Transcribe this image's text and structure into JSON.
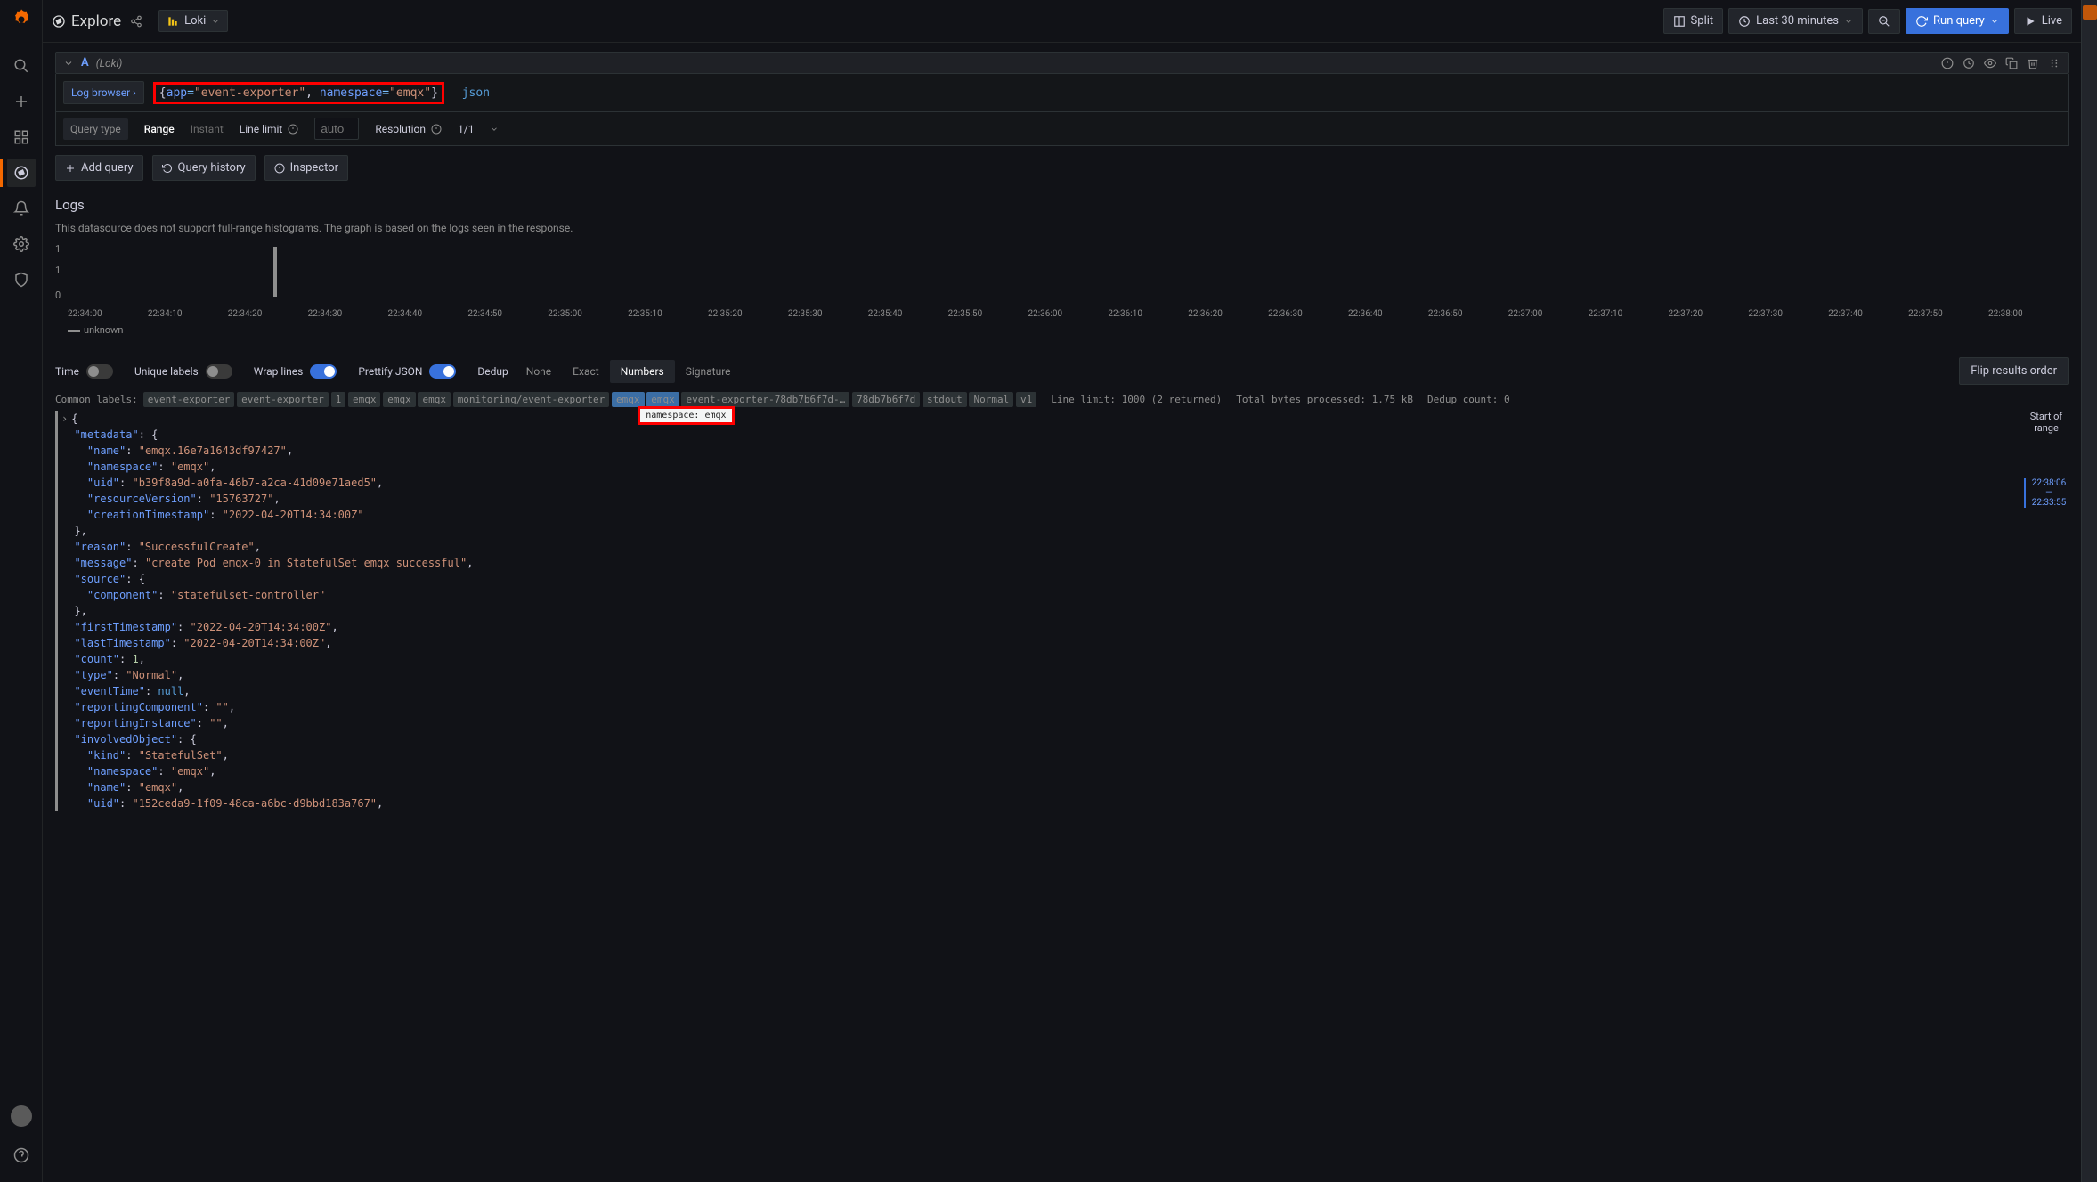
{
  "topbar": {
    "title": "Explore",
    "datasource": "Loki",
    "split": "Split",
    "timerange": "Last 30 minutes",
    "run_query": "Run query",
    "live": "Live"
  },
  "query": {
    "letter": "A",
    "ds_label": "(Loki)",
    "log_browser": "Log browser",
    "query_app_key": "app",
    "query_app_val": "\"event-exporter\"",
    "query_ns_key": "namespace",
    "query_ns_val": "\"emqx\"",
    "pipe": "json",
    "query_type_label": "Query type",
    "range": "Range",
    "instant": "Instant",
    "line_limit_label": "Line limit",
    "line_limit_placeholder": "auto",
    "resolution_label": "Resolution",
    "resolution_value": "1/1"
  },
  "actions": {
    "add_query": "Add query",
    "query_history": "Query history",
    "inspector": "Inspector"
  },
  "logs": {
    "title": "Logs",
    "note": "This datasource does not support full-range histograms. The graph is based on the logs seen in the response.",
    "legend_unknown": "unknown"
  },
  "chart_data": {
    "type": "bar",
    "x_ticks": [
      "22:34:00",
      "22:34:10",
      "22:34:20",
      "22:34:30",
      "22:34:40",
      "22:34:50",
      "22:35:00",
      "22:35:10",
      "22:35:20",
      "22:35:30",
      "22:35:40",
      "22:35:50",
      "22:36:00",
      "22:36:10",
      "22:36:20",
      "22:36:30",
      "22:36:40",
      "22:36:50",
      "22:37:00",
      "22:37:10",
      "22:37:20",
      "22:37:30",
      "22:37:40",
      "22:37:50",
      "22:38:00"
    ],
    "y_ticks": [
      0,
      1,
      1
    ],
    "series": [
      {
        "name": "unknown",
        "bars": [
          {
            "x": "22:34:20",
            "value": 1
          }
        ]
      }
    ]
  },
  "controls": {
    "time": "Time",
    "unique_labels": "Unique labels",
    "wrap_lines": "Wrap lines",
    "prettify": "Prettify JSON",
    "dedup": "Dedup",
    "dedup_none": "None",
    "dedup_exact": "Exact",
    "dedup_numbers": "Numbers",
    "dedup_signature": "Signature",
    "flip": "Flip results order"
  },
  "common_labels": {
    "title": "Common labels:",
    "labels": [
      "event-exporter",
      "event-exporter",
      "1",
      "emqx",
      "emqx",
      "emqx",
      "monitoring/event-exporter",
      "emqx",
      "emqx",
      "event-exporter-78db7b6f7d-…",
      "78db7b6f7d",
      "stdout",
      "Normal",
      "v1"
    ],
    "highlighted_indices": [
      7,
      8
    ],
    "tooltip": "namespace: emqx",
    "line_limit": "Line limit: 1000 (2 returned)",
    "bytes": "Total bytes processed: 1.75 kB",
    "dedup_count": "Dedup count: 0"
  },
  "log_entry": {
    "lines": [
      "{",
      "  \"metadata\": {",
      "    \"name\": \"emqx.16e7a1643df97427\",",
      "    \"namespace\": \"emqx\",",
      "    \"uid\": \"b39f8a9d-a0fa-46b7-a2ca-41d09e71aed5\",",
      "    \"resourceVersion\": \"15763727\",",
      "    \"creationTimestamp\": \"2022-04-20T14:34:00Z\"",
      "  },",
      "  \"reason\": \"SuccessfulCreate\",",
      "  \"message\": \"create Pod emqx-0 in StatefulSet emqx successful\",",
      "  \"source\": {",
      "    \"component\": \"statefulset-controller\"",
      "  },",
      "  \"firstTimestamp\": \"2022-04-20T14:34:00Z\",",
      "  \"lastTimestamp\": \"2022-04-20T14:34:00Z\",",
      "  \"count\": 1,",
      "  \"type\": \"Normal\",",
      "  \"eventTime\": null,",
      "  \"reportingComponent\": \"\",",
      "  \"reportingInstance\": \"\",",
      "  \"involvedObject\": {",
      "    \"kind\": \"StatefulSet\",",
      "    \"namespace\": \"emqx\",",
      "    \"name\": \"emqx\",",
      "    \"uid\": \"152ceda9-1f09-48ca-a6bc-d9bbd183a767\","
    ]
  },
  "range_indicator": {
    "start_label": "Start of range",
    "t1": "22:38:06",
    "dash": "—",
    "t2": "22:33:55"
  }
}
